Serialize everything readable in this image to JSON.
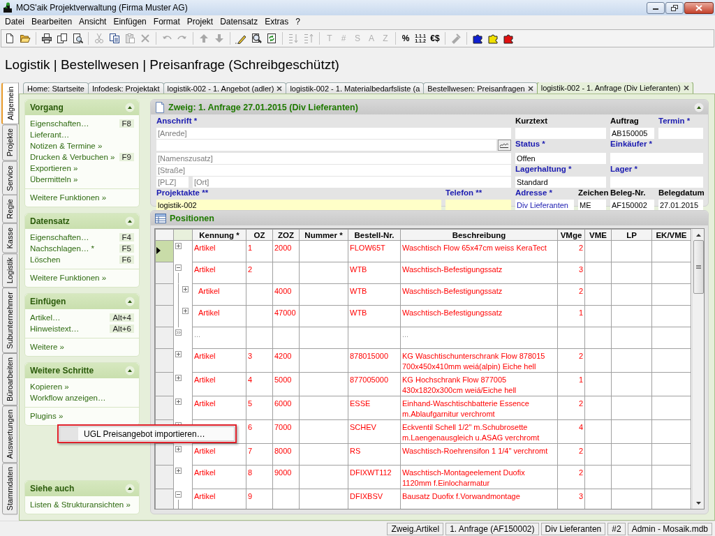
{
  "window": {
    "title": "MOS'aik Projektverwaltung (Firma Muster AG)"
  },
  "menu": [
    "Datei",
    "Bearbeiten",
    "Ansicht",
    "Einfügen",
    "Format",
    "Projekt",
    "Datensatz",
    "Extras",
    "?"
  ],
  "toolbar": [
    {
      "kind": "new"
    },
    {
      "kind": "open"
    },
    {
      "kind": "separator"
    },
    {
      "kind": "print"
    },
    {
      "kind": "pages"
    },
    {
      "kind": "preview"
    },
    {
      "kind": "separator"
    },
    {
      "kind": "cut",
      "disabled": true
    },
    {
      "kind": "copy",
      "disabled": false
    },
    {
      "kind": "paste",
      "disabled": true
    },
    {
      "kind": "delete",
      "disabled": true
    },
    {
      "kind": "separator"
    },
    {
      "kind": "undo",
      "disabled": true
    },
    {
      "kind": "redo",
      "disabled": true
    },
    {
      "kind": "separator"
    },
    {
      "kind": "up",
      "disabled": true
    },
    {
      "kind": "down",
      "disabled": true
    },
    {
      "kind": "separator"
    },
    {
      "kind": "edit"
    },
    {
      "kind": "find"
    },
    {
      "kind": "refresh"
    },
    {
      "kind": "separator"
    },
    {
      "kind": "ascending",
      "disabled": true
    },
    {
      "kind": "descending",
      "disabled": true
    },
    {
      "kind": "separator"
    },
    {
      "kind": "glyph",
      "label": "T",
      "disabled": true
    },
    {
      "kind": "glyph",
      "label": "#",
      "disabled": true
    },
    {
      "kind": "glyph",
      "label": "S",
      "disabled": true
    },
    {
      "kind": "glyph",
      "label": "A",
      "disabled": true
    },
    {
      "kind": "glyph",
      "label": "Z",
      "disabled": true
    },
    {
      "kind": "separator"
    },
    {
      "kind": "glyph",
      "label": "%",
      "disabled": false
    },
    {
      "kind": "numbering",
      "label": "1.1.1 1.1.2",
      "disabled": false
    },
    {
      "kind": "glyph",
      "label": "€$",
      "disabled": false
    },
    {
      "kind": "separator"
    },
    {
      "kind": "tools",
      "disabled": true
    },
    {
      "kind": "separator"
    },
    {
      "kind": "puzzle",
      "color": "#1020d0"
    },
    {
      "kind": "puzzle",
      "color": "#f0e000"
    },
    {
      "kind": "puzzle",
      "color": "#e01010"
    }
  ],
  "heading": "Logistik | Bestellwesen | Preisanfrage (Schreibgeschützt)",
  "side_tabs": [
    {
      "label": "Allgemein",
      "selected": true
    },
    {
      "label": "Projekte",
      "selected": false
    },
    {
      "label": "Service",
      "selected": false
    },
    {
      "label": "Regie",
      "selected": false
    },
    {
      "label": "Kasse",
      "selected": false
    },
    {
      "label": "Logistik",
      "selected": false
    },
    {
      "label": "Subunternehmer",
      "selected": false
    },
    {
      "label": "Büroarbeiten",
      "selected": false
    },
    {
      "label": "Auswertungen",
      "selected": false
    },
    {
      "label": "Stammdaten",
      "selected": false
    }
  ],
  "doc_tabs": [
    {
      "label": "Home: Startseite",
      "closable": false,
      "selected": false
    },
    {
      "label": "Infodesk: Projektakt",
      "closable": false,
      "selected": false
    },
    {
      "label": "logistik-002 - 1. Angebot (adler)",
      "closable": true,
      "selected": false
    },
    {
      "label": "logistik-002 - 1. Materialbedarfsliste (a",
      "closable": false,
      "selected": false
    },
    {
      "label": "Bestellwesen: Preisanfragen",
      "closable": true,
      "selected": false
    },
    {
      "label": "logistik-002 - 1. Anfrage (Div Lieferanten)",
      "closable": true,
      "selected": true
    }
  ],
  "task_groups": [
    {
      "title": "Vorgang",
      "sections": [
        [
          {
            "label": "Eigenschaften…",
            "shortcut": "F8"
          },
          {
            "label": "Lieferant…"
          },
          {
            "label": "Notizen & Termine »"
          },
          {
            "label": "Drucken & Verbuchen »",
            "shortcut": "F9"
          },
          {
            "label": "Exportieren »"
          },
          {
            "label": "Übermitteln »"
          }
        ],
        [
          {
            "label": "Weitere Funktionen »"
          }
        ]
      ]
    },
    {
      "title": "Datensatz",
      "sections": [
        [
          {
            "label": "Eigenschaften…",
            "shortcut": "F4"
          },
          {
            "label": "Nachschlagen… *",
            "shortcut": "F5"
          },
          {
            "label": "Löschen",
            "shortcut": "F6"
          }
        ],
        [
          {
            "label": "Weitere Funktionen »"
          }
        ]
      ]
    },
    {
      "title": "Einfügen",
      "sections": [
        [
          {
            "label": "Artikel…",
            "shortcut": "Alt+4"
          },
          {
            "label": "Hinweistext…",
            "shortcut": "Alt+6"
          }
        ],
        [
          {
            "label": "Weitere »"
          }
        ]
      ]
    },
    {
      "title": "Weitere Schritte",
      "sections": [
        [
          {
            "label": "Kopieren »"
          },
          {
            "label": "Workflow anzeigen…"
          }
        ],
        [
          {
            "label": "Plugins »"
          }
        ]
      ]
    },
    {
      "title": "Siehe auch",
      "sections": [
        [
          {
            "label": "Listen & Strukturansichten »"
          }
        ]
      ]
    }
  ],
  "context_menu": {
    "items": [
      {
        "label": "UGL Preisangebot importieren…",
        "selected": true
      }
    ]
  },
  "form": {
    "title": "Zweig: 1. Anfrage 27.01.2015 (Div Lieferanten)",
    "anschrift": {
      "label": "Anschrift *",
      "required": true
    },
    "anrede": {
      "placeholder": "[Anrede]"
    },
    "namenszusatz": {
      "placeholder": "[Namenszusatz]"
    },
    "strasse": {
      "placeholder": "[Straße]"
    },
    "plz": {
      "placeholder": "[PLZ]"
    },
    "ort": {
      "placeholder": "[Ort]"
    },
    "projektakte": {
      "label": "Projektakte **",
      "required": true,
      "value": "logistik-002",
      "highlighted": true
    },
    "telefon": {
      "label": "Telefon **",
      "required": true,
      "highlighted": true
    },
    "kurztext": {
      "label": "Kurztext",
      "required": false
    },
    "auftrag": {
      "label": "Auftrag",
      "required": false,
      "value": "AB150005"
    },
    "termin": {
      "label": "Termin *",
      "required": true
    },
    "status": {
      "label": "Status *",
      "required": true,
      "value": "Offen"
    },
    "einkaeufer": {
      "label": "Einkäufer *",
      "required": true
    },
    "lagerhaltung": {
      "label": "Lagerhaltung *",
      "required": true,
      "value": "Standard"
    },
    "lager": {
      "label": "Lager *",
      "required": true
    },
    "adresse": {
      "label": "Adresse *",
      "required": true,
      "value": "Div Lieferanten",
      "link": true
    },
    "zeichen": {
      "label": "Zeichen",
      "required": false,
      "value": "ME"
    },
    "beleg_nr": {
      "label": "Beleg-Nr.",
      "required": false,
      "value": "AF150002"
    },
    "belegdatum": {
      "label": "Belegdatum",
      "required": false,
      "value": "27.01.2015"
    }
  },
  "positions": {
    "title": "Positionen",
    "columns": [
      "Kennung *",
      "OZ",
      "ZOZ",
      "Nummer *",
      "Bestell-Nr.",
      "Beschreibung",
      "VMge",
      "VME",
      "LP",
      "EK/VME"
    ],
    "rows": [
      {
        "kind": "item",
        "selected": true,
        "expanded": false,
        "kennung": "Artikel",
        "oz": "1",
        "zoz": "2000",
        "bestell_nr": "FLOW65T",
        "beschreibung": "Waschtisch Flow 65x47cm weiss KeraTect",
        "vmge": "2"
      },
      {
        "kind": "item",
        "selected": false,
        "expanded": true,
        "kennung": "Artikel",
        "oz": "2",
        "bestell_nr": "WTB",
        "beschreibung": "Waschtisch-Befestigungssatz",
        "vmge": "3",
        "children": [
          {
            "kind": "item",
            "selected": false,
            "expanded": false,
            "kennung": "Artikel",
            "zoz": "4000",
            "bestell_nr": "WTB",
            "beschreibung": "Waschtisch-Befestigungssatz",
            "vmge": "2"
          },
          {
            "kind": "item",
            "selected": false,
            "expanded": false,
            "kennung": "Artikel",
            "zoz": "47000",
            "bestell_nr": "WTB",
            "beschreibung": "Waschtisch-Befestigungssatz",
            "vmge": "1"
          }
        ]
      },
      {
        "kind": "more",
        "selected": false,
        "kennung": "...",
        "beschreibung": "..."
      },
      {
        "kind": "item",
        "selected": false,
        "expanded": false,
        "kennung": "Artikel",
        "oz": "3",
        "zoz": "4200",
        "bestell_nr": "878015000",
        "beschreibung": "KG Waschtischunterschrank Flow 878015 700x450x410mm weiá(alpin) Eiche hell",
        "vmge": "2"
      },
      {
        "kind": "item",
        "selected": false,
        "expanded": false,
        "kennung": "Artikel",
        "oz": "4",
        "zoz": "5000",
        "bestell_nr": "877005000",
        "beschreibung": "KG Hochschrank Flow 877005 430x1820x300cm weiá/Eiche hell",
        "vmge": "1"
      },
      {
        "kind": "item",
        "selected": false,
        "expanded": false,
        "kennung": "Artikel",
        "oz": "5",
        "zoz": "6000",
        "bestell_nr": "ESSE",
        "beschreibung": "Einhand-Waschtischbatterie Essence m.Ablaufgarnitur verchromt",
        "vmge": "2"
      },
      {
        "kind": "item",
        "selected": false,
        "oz": "6",
        "zoz": "7000",
        "bestell_nr": "SCHEV",
        "beschreibung": "Eckventil Schell 1/2\" m.Schubrosette m.Laengenausgleich u.ASAG verchromt",
        "vmge": "4"
      },
      {
        "kind": "item",
        "selected": false,
        "expanded": false,
        "kennung": "Artikel",
        "oz": "7",
        "zoz": "8000",
        "bestell_nr": "RS",
        "beschreibung": "Waschtisch-Roehrensifon 1 1/4\" verchromt",
        "vmge": "2"
      },
      {
        "kind": "item",
        "selected": false,
        "expanded": false,
        "kennung": "Artikel",
        "oz": "8",
        "zoz": "9000",
        "bestell_nr": "DFIXWT112",
        "beschreibung": "Waschtisch-Montageelement Duofix 1120mm f.Einlocharmatur",
        "vmge": "2"
      },
      {
        "kind": "item",
        "selected": false,
        "expanded": true,
        "kennung": "Artikel",
        "oz": "9",
        "bestell_nr": "DFIXBSV",
        "beschreibung": "Bausatz Duofix f.Vorwandmontage",
        "vmge": "3"
      }
    ]
  },
  "status_bar": [
    "Zweig.Artikel",
    "1. Anfrage (AF150002)",
    "Div Lieferanten",
    "#2",
    "Admin - Mosaik.mdb"
  ]
}
